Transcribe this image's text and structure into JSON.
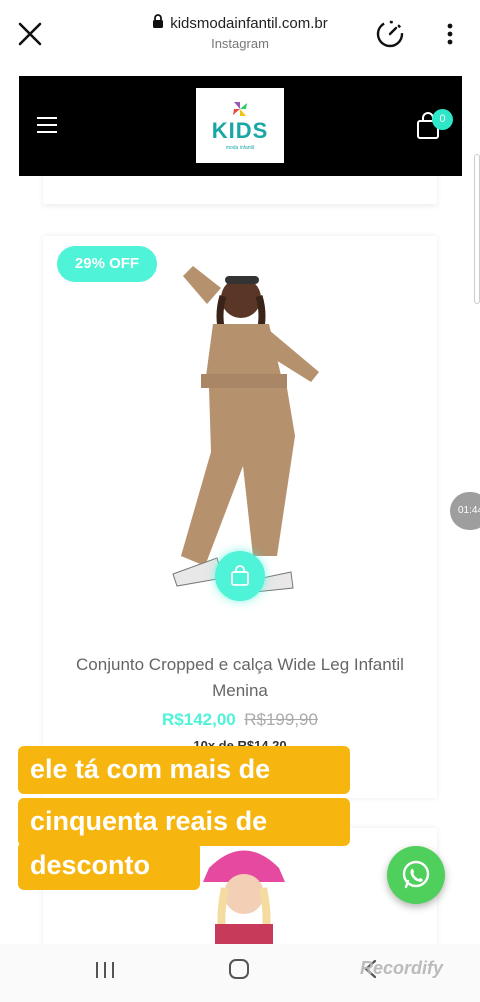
{
  "browser": {
    "domain": "kidsmodainfantil.com.br",
    "source": "Instagram",
    "icons": {
      "close": "close-icon",
      "lock": "lock-icon",
      "timer": "timer-icon",
      "more": "more-vert-icon"
    }
  },
  "header": {
    "logo_text": "KIDS",
    "logo_sub": "moda infantil",
    "cart_count": "0",
    "icons": {
      "menu": "menu-icon",
      "cart": "shopping-bag-icon"
    }
  },
  "product": {
    "discount": "29% OFF",
    "title": "Conjunto Cropped e calça Wide Leg Infantil Menina",
    "price": "R$142,00",
    "old_price": "R$199,90",
    "installment": "10x de R$14,20"
  },
  "caption": {
    "line1": "ele tá com mais de",
    "line2": "cinquenta reais de",
    "line3": "desconto"
  },
  "timer_chip": "01:44",
  "watermark": "Recordify",
  "colors": {
    "accent": "#4ff3d7",
    "caption_bg": "#f6b60f",
    "whatsapp": "#4fcf5c",
    "logo": "#18a7a5"
  }
}
